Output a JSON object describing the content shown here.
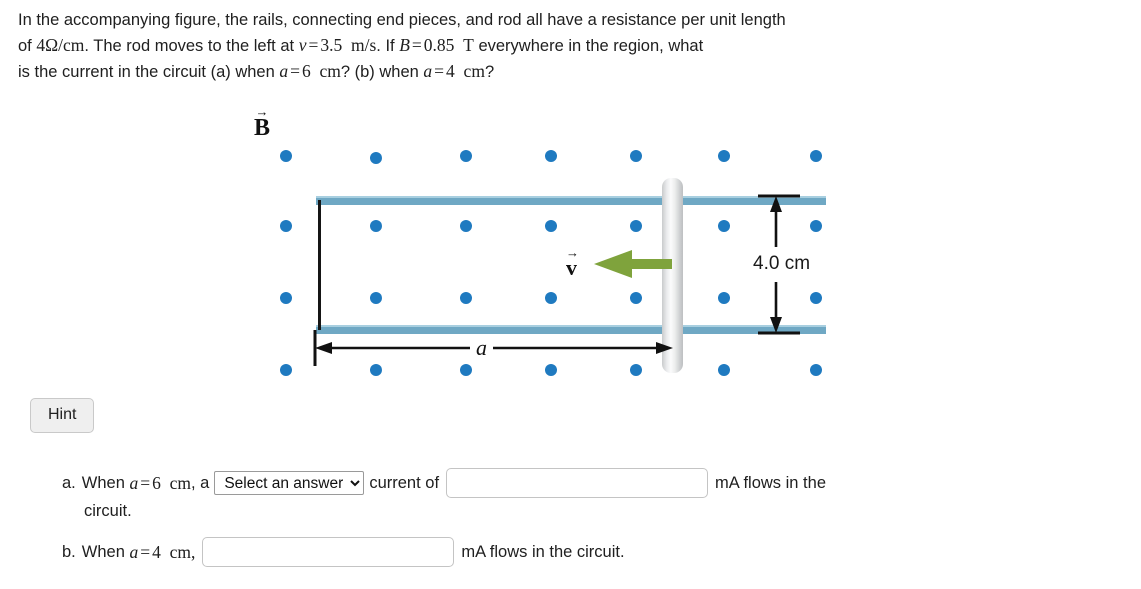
{
  "problem": {
    "line1_prefix": "In the accompanying figure, the rails, connecting end pieces, and rod all have a resistance per unit length",
    "line2_a": "of ",
    "resistance_value": "4",
    "resistance_unit": "Ω",
    "per": "/",
    "length_unit": "cm",
    "line2_b": ". The rod moves to the left at ",
    "v_symbol": "v",
    "equals": "=",
    "v_value": "3.5",
    "v_unit_num": "m",
    "v_unit_den": "s",
    "line2_c": ". If ",
    "B_symbol": "B",
    "B_value": "0.85",
    "B_unit": "T",
    "line2_d": " everywhere in the region, what",
    "line3_a": "is the current in the circuit (a) when ",
    "a_symbol": "a",
    "a_value_1": "6",
    "cm": "cm",
    "line3_b": "? (b) when ",
    "a_value_2": "4",
    "line3_c": "?"
  },
  "figure": {
    "field_label": "B",
    "field_arrow": "→",
    "velocity_label": "v",
    "velocity_arrow": "→",
    "width_dimension": "4.0 cm",
    "length_dimension": "a",
    "colors": {
      "dot": "#1f7ac0",
      "rail": "#6fa8c4",
      "rail_highlight": "#a8cfe0",
      "velocity_arrow": "#7fa33c",
      "rod": "#e6e7e8",
      "end_piece": "#151515"
    },
    "dot_rows": 4,
    "dot_cols": 7
  },
  "hint": {
    "label": "Hint"
  },
  "answers": {
    "part_a": {
      "marker": "a.",
      "when": "When ",
      "a_symbol": "a",
      "equals": "=",
      "a_value": "6",
      "cm": "cm",
      "comma_a": ", a",
      "select_value": "Select an answer",
      "select_options": [
        "Select an answer"
      ],
      "mid_text": "current of",
      "input_value": "",
      "input_placeholder": "",
      "unit_text": "mA flows in the",
      "continuation": "circuit."
    },
    "part_b": {
      "marker": "b.",
      "when": "When ",
      "a_symbol": "a",
      "equals": "=",
      "a_value": "4",
      "cm": "cm,",
      "input_value": "",
      "input_placeholder": "",
      "unit_text": "mA flows in the circuit."
    }
  }
}
